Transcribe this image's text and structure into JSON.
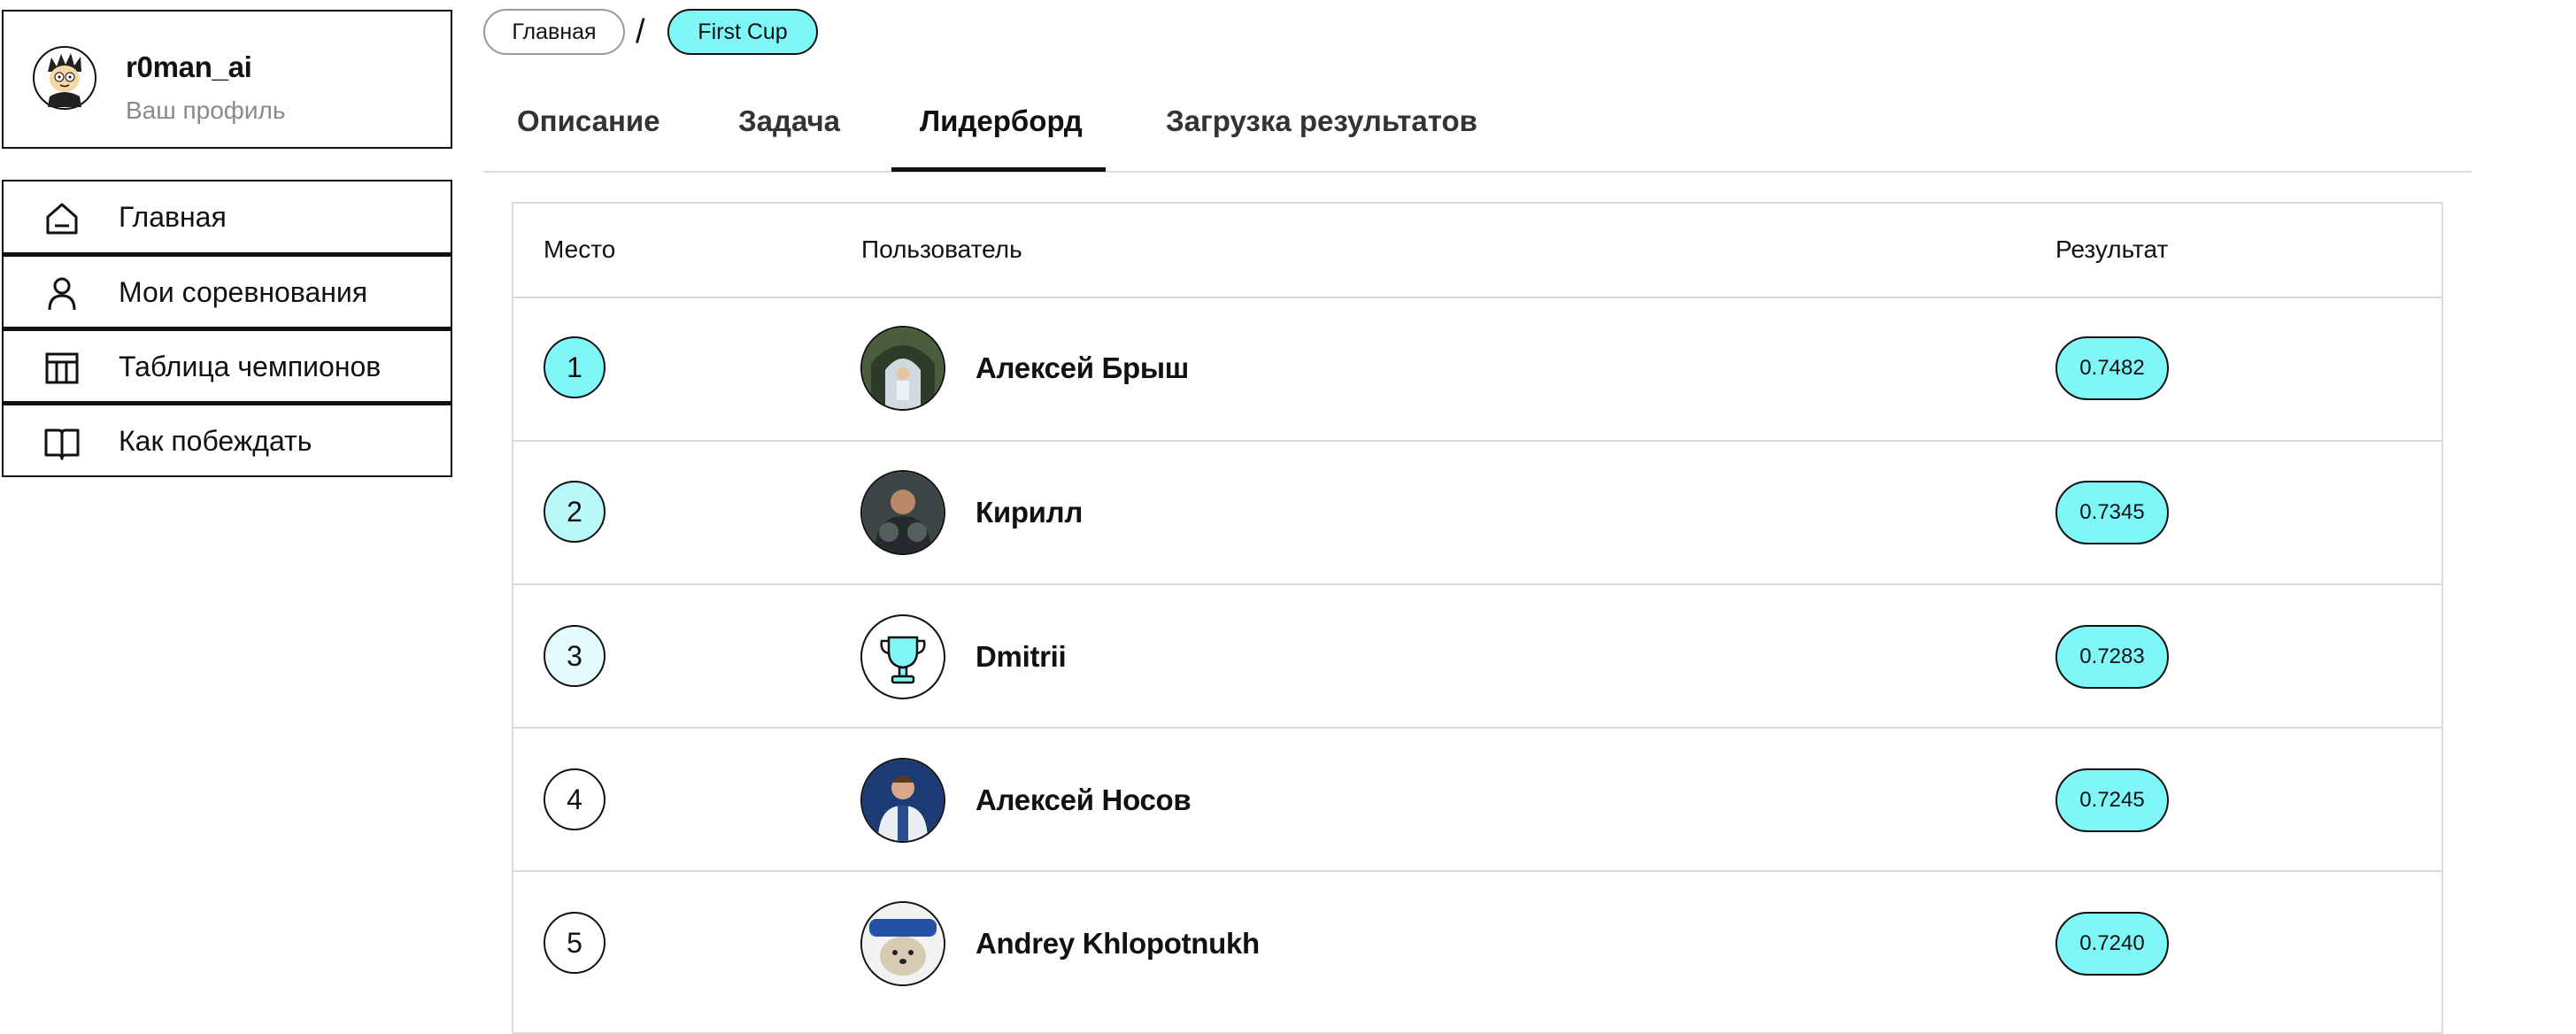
{
  "profile": {
    "username": "r0man_ai",
    "subtitle": "Ваш профиль",
    "avatar_icon": "cartoon-avatar"
  },
  "sidebar": {
    "items": [
      {
        "label": "Главная",
        "icon": "home-icon"
      },
      {
        "label": "Мои соревнования",
        "icon": "user-icon"
      },
      {
        "label": "Таблица чемпионов",
        "icon": "table-icon"
      },
      {
        "label": "Как побеждать",
        "icon": "book-icon"
      }
    ]
  },
  "breadcrumb": {
    "home": "Главная",
    "separator": "/",
    "current": "First Cup"
  },
  "tabs": [
    {
      "label": "Описание",
      "active": false
    },
    {
      "label": "Задача",
      "active": false
    },
    {
      "label": "Лидерборд",
      "active": true
    },
    {
      "label": "Загрузка результатов",
      "active": false
    }
  ],
  "leaderboard": {
    "headers": {
      "place": "Место",
      "user": "Пользователь",
      "result": "Результат"
    },
    "rows": [
      {
        "place": "1",
        "name": "Алексей Брыш",
        "score": "0.7482",
        "rank_color": "#7ff6f8",
        "avatar": "photo-arch"
      },
      {
        "place": "2",
        "name": "Кирилл",
        "score": "0.7345",
        "rank_color": "#b9f8f9",
        "avatar": "photo-athlete"
      },
      {
        "place": "3",
        "name": "Dmitrii",
        "score": "0.7283",
        "rank_color": "#e3fbfc",
        "avatar": "trophy-icon"
      },
      {
        "place": "4",
        "name": "Алексей Носов",
        "score": "0.7245",
        "rank_color": "#ffffff",
        "avatar": "photo-speaker"
      },
      {
        "place": "5",
        "name": "Andrey Khlopotnukh",
        "score": "0.7240",
        "rank_color": "#ffffff",
        "avatar": "photo-cat"
      }
    ]
  },
  "colors": {
    "accent": "#7ff6f8",
    "border": "#111111",
    "muted": "#8a8a8a",
    "divider": "#dadada"
  }
}
